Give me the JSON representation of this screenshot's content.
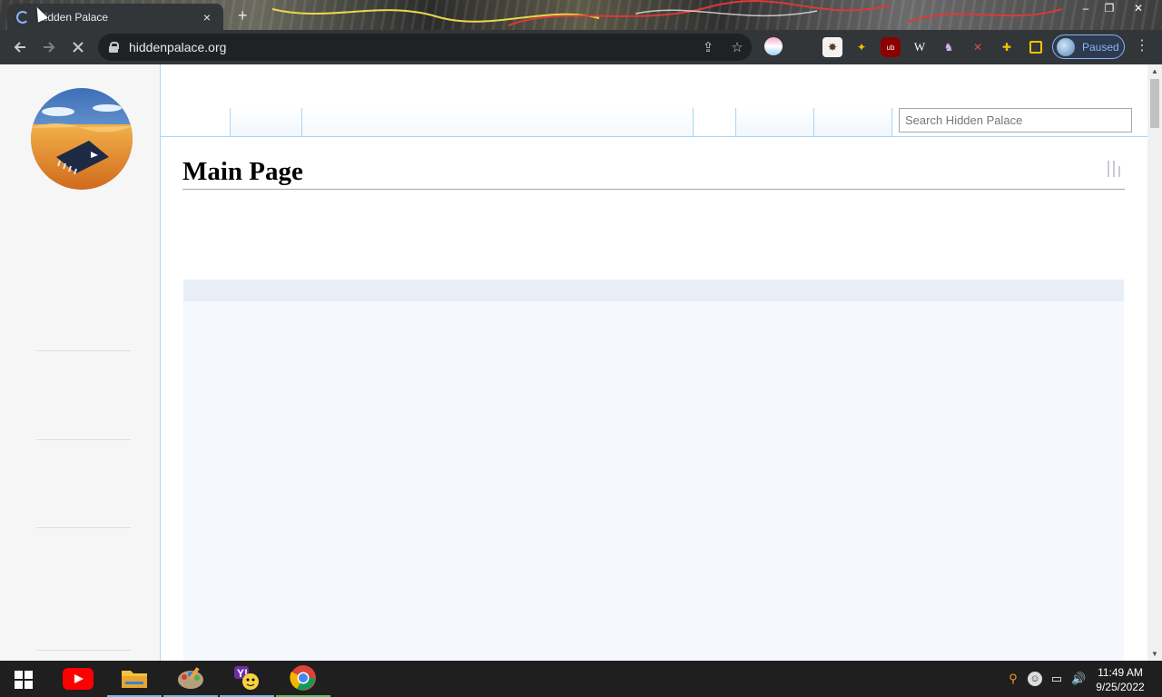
{
  "browser": {
    "tab_title": "Hidden Palace",
    "tab_close": "×",
    "new_tab": "+",
    "url": "hiddenpalace.org",
    "profile_label": "Paused",
    "window_controls": [
      "–",
      "❐",
      "✕"
    ],
    "nav_icons": [
      "back-icon",
      "forward-icon",
      "loading-icon"
    ],
    "extensions": [
      "color-picker-extension",
      "paw-extension",
      "runner-extension",
      "ublock-extension",
      "wikipedia-extension",
      "figure-extension",
      "dna-extension",
      "puzzle-extension",
      "sidebar-extension"
    ]
  },
  "page": {
    "title": "Main Page",
    "search_placeholder": "Search Hidden Palace"
  },
  "taskbar": {
    "apps": [
      "youtube-icon",
      "file-explorer-icon",
      "paint-app-icon",
      "yahoo-messenger-icon",
      "chrome-icon"
    ],
    "time": "11:49 AM",
    "date": "9/25/2022"
  },
  "colors": {
    "accent_link_border": "#a7d7f9",
    "box_background": "#f5f8fc",
    "profile_text": "#8ab4f8"
  }
}
